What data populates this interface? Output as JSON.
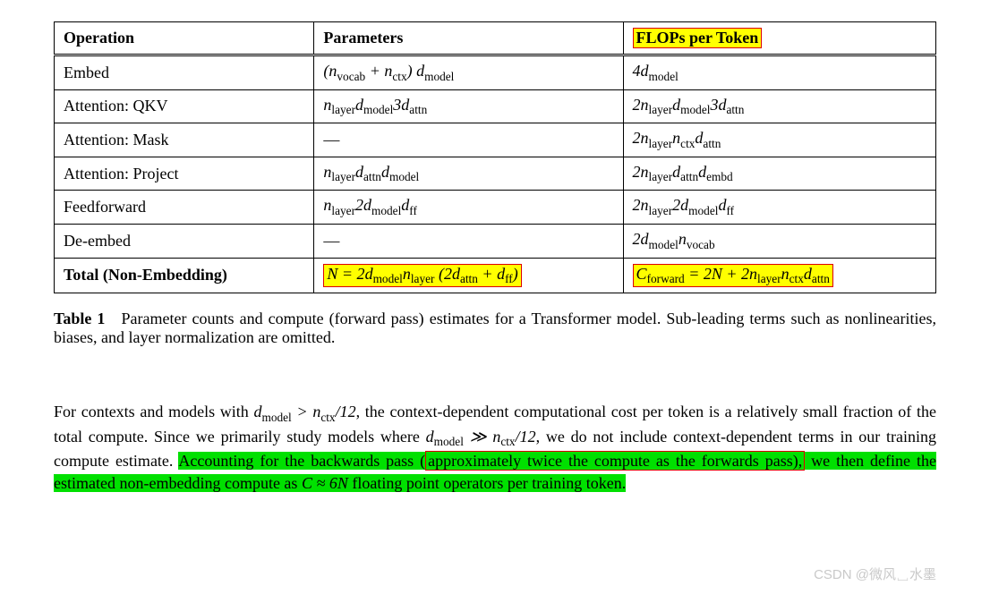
{
  "table": {
    "headers": {
      "col1": "Operation",
      "col2": "Parameters",
      "col3": "FLOPs per Token"
    },
    "rows": [
      {
        "op": "Embed",
        "params": "(n_{vocab} + n_{ctx}) d_{model}",
        "flops": "4d_{model}"
      },
      {
        "op": "Attention: QKV",
        "params": "n_{layer}d_{model}3d_{attn}",
        "flops": "2n_{layer}d_{model}3d_{attn}"
      },
      {
        "op": "Attention: Mask",
        "params": "—",
        "flops": "2n_{layer}n_{ctx}d_{attn}"
      },
      {
        "op": "Attention: Project",
        "params": "n_{layer}d_{attn}d_{model}",
        "flops": "2n_{layer}d_{attn}d_{embd}"
      },
      {
        "op": "Feedforward",
        "params": "n_{layer}2d_{model}d_{ff}",
        "flops": "2n_{layer}2d_{model}d_{ff}"
      },
      {
        "op": "De-embed",
        "params": "—",
        "flops": "2d_{model}n_{vocab}"
      }
    ],
    "total": {
      "label": "Total (Non-Embedding)",
      "params": "N = 2d_{model}n_{layer}(2d_{attn} + d_{ff})",
      "flops": "C_{forward} = 2N + 2n_{layer}n_{ctx}d_{attn}"
    }
  },
  "caption": {
    "lead": "Table 1",
    "text": "Parameter counts and compute (forward pass) estimates for a Transformer model. Sub-leading terms such as nonlinearities, biases, and layer normalization are omitted."
  },
  "paragraph": {
    "seg1": "For contexts and models with ",
    "cond1": "d_{model} > n_{ctx}/12",
    "seg2": ", the context-dependent computational cost per token is a relatively small fraction of the total compute. Since we primarily study models where ",
    "cond2": "d_{model} ≫ n_{ctx}/12",
    "seg3": ", we do not include context-dependent terms in our training compute estimate. ",
    "hl1a": "Accounting for the backwards pass (",
    "hl1b": "approximately twice the compute as the forwards pass),",
    "hl2": " we then define the estimated non-embedding compute as ",
    "hl_formula": "C ≈ 6N",
    "hl3": " floating point operators per training token."
  },
  "watermark": "CSDN @微风␣水墨",
  "chart_data": {
    "type": "table",
    "title": "Parameter counts and compute (forward pass) estimates for a Transformer model",
    "columns": [
      "Operation",
      "Parameters",
      "FLOPs per Token"
    ],
    "rows": [
      [
        "Embed",
        "(n_vocab + n_ctx) d_model",
        "4 d_model"
      ],
      [
        "Attention: QKV",
        "n_layer d_model 3 d_attn",
        "2 n_layer d_model 3 d_attn"
      ],
      [
        "Attention: Mask",
        "—",
        "2 n_layer n_ctx d_attn"
      ],
      [
        "Attention: Project",
        "n_layer d_attn d_model",
        "2 n_layer d_attn d_embd"
      ],
      [
        "Feedforward",
        "n_layer 2 d_model d_ff",
        "2 n_layer 2 d_model d_ff"
      ],
      [
        "De-embed",
        "—",
        "2 d_model n_vocab"
      ],
      [
        "Total (Non-Embedding)",
        "N = 2 d_model n_layer (2 d_attn + d_ff)",
        "C_forward = 2N + 2 n_layer n_ctx d_attn"
      ]
    ]
  }
}
